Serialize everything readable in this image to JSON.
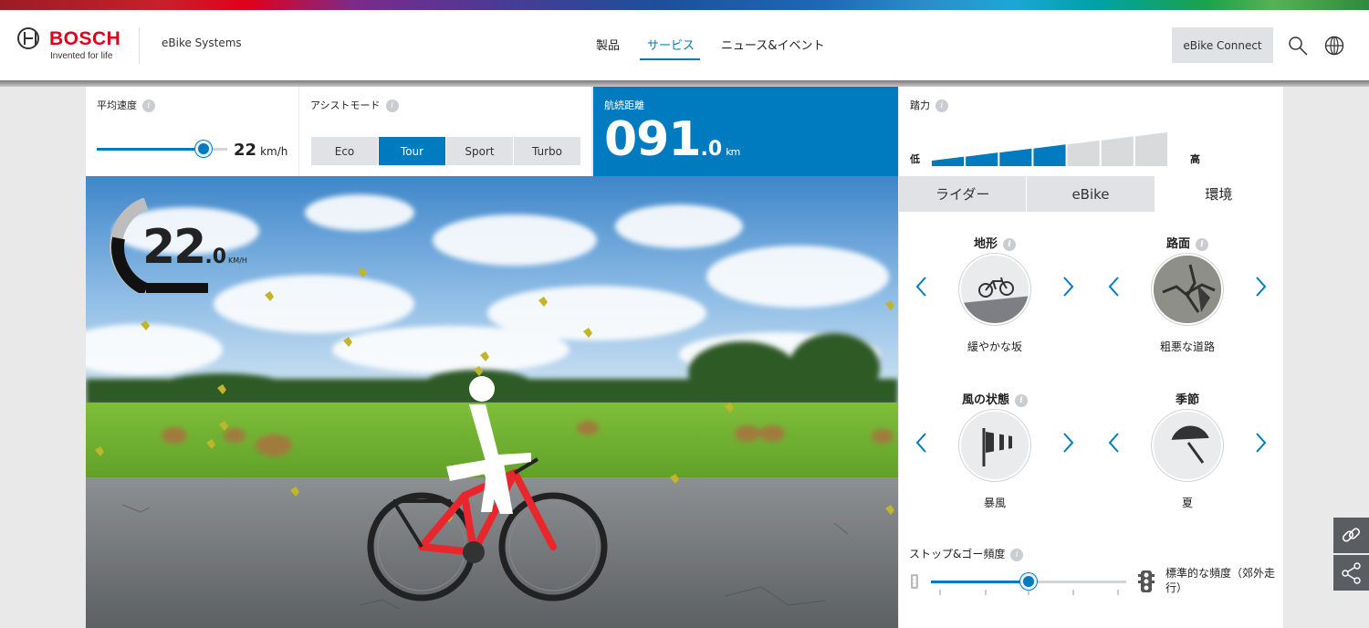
{
  "brand": {
    "name": "BOSCH",
    "tagline": "Invented for life",
    "site": "eBike Systems"
  },
  "nav": [
    {
      "label": "製品"
    },
    {
      "label": "サービス",
      "active": true
    },
    {
      "label": "ニュース&イベント"
    }
  ],
  "header": {
    "connect_label": "eBike Connect"
  },
  "speed_panel": {
    "label": "平均速度",
    "value": "22",
    "unit": "km/h",
    "slider_fraction": 0.82
  },
  "assist_panel": {
    "label": "アシストモード",
    "modes": [
      "Eco",
      "Tour",
      "Sport",
      "Turbo"
    ],
    "active": "Tour"
  },
  "range_panel": {
    "label": "航続距離",
    "value_int": "091",
    "value_dec": ".0",
    "unit": "km"
  },
  "power_panel": {
    "label": "踏力",
    "low": "低",
    "high": "高",
    "level": 4,
    "levels": 7
  },
  "speedometer": {
    "value_int": "22",
    "value_dec": ".0",
    "unit": "KM/H"
  },
  "config": {
    "tabs": [
      "ライダー",
      "eBike",
      "環境"
    ],
    "active_tab": "環境",
    "terrain": {
      "title": "地形",
      "caption": "緩やかな坂"
    },
    "surface": {
      "title": "路面",
      "caption": "粗悪な道路"
    },
    "wind": {
      "title": "風の状態",
      "caption": "暴風"
    },
    "season": {
      "title": "季節",
      "caption": "夏"
    },
    "stopgo": {
      "label": "ストップ&ゴー頻度",
      "value": "標準的な頻度（郊外走行）",
      "fraction": 0.5
    }
  },
  "colors": {
    "accent": "#007bc0",
    "brand_red": "#e2001a",
    "bike_red": "#e8262c"
  },
  "icons": [
    "search-icon",
    "globe-icon",
    "info-icon",
    "chevron-left-icon",
    "chevron-right-icon",
    "bicycle-icon",
    "windsock-icon",
    "umbrella-icon",
    "traffic-light-icon",
    "link-icon",
    "share-icon"
  ]
}
